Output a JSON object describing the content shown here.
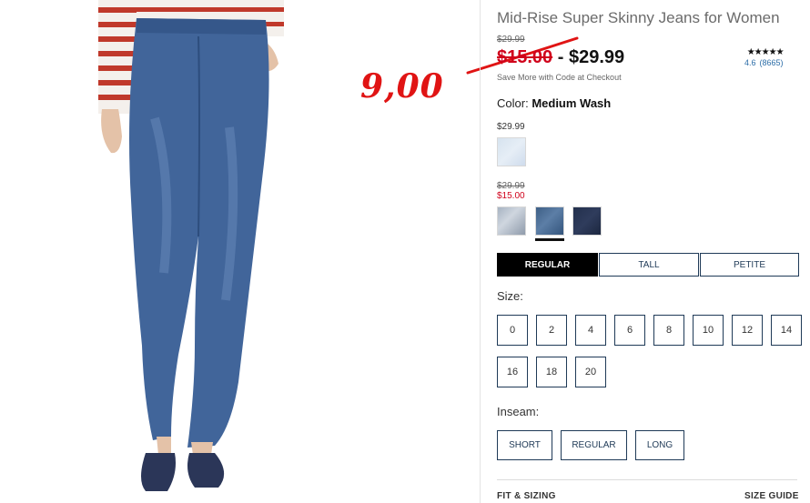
{
  "product": {
    "title": "Mid-Rise Super Skinny Jeans for Women",
    "original_price": "$29.99",
    "sale_price": "$15.00",
    "price_separator": "-",
    "full_price": "$29.99",
    "promo_text": "Save More with Code at Checkout"
  },
  "rating": {
    "stars": "★★★★★",
    "score": "4.6",
    "count": "(8665)"
  },
  "annotation": {
    "handwritten_price": "9,00"
  },
  "color": {
    "label": "Color:",
    "selected": "Medium Wash",
    "group1_price": "$29.99",
    "group2_original": "$29.99",
    "group2_sale": "$15.00",
    "swatches": [
      "light-wash",
      "faded-wash",
      "medium-wash",
      "dark-wash"
    ]
  },
  "fit_tabs": [
    "REGULAR",
    "TALL",
    "PETITE"
  ],
  "size": {
    "label": "Size:",
    "options": [
      "0",
      "2",
      "4",
      "6",
      "8",
      "10",
      "12",
      "14",
      "16",
      "18",
      "20"
    ]
  },
  "inseam": {
    "label": "Inseam:",
    "options": [
      "SHORT",
      "REGULAR",
      "LONG"
    ]
  },
  "footer": {
    "fit_sizing": "FIT & SIZING",
    "size_guide": "SIZE GUIDE"
  },
  "colors": {
    "sale_red": "#d0021b",
    "navy": "#1f3a57",
    "annotation_red": "#e01414"
  }
}
